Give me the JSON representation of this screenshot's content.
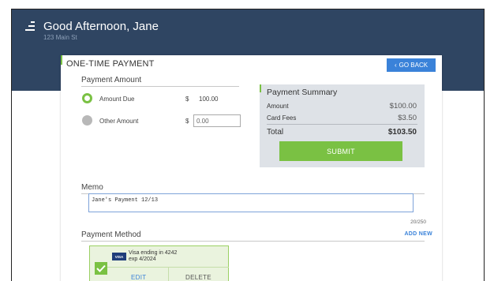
{
  "header": {
    "greeting": "Good Afternoon, Jane",
    "address": "123 Main St"
  },
  "card": {
    "title": "ONE-TIME PAYMENT",
    "go_back_label": "GO BACK",
    "go_back_icon": "chevron-left-icon"
  },
  "payment_amount": {
    "section_label": "Payment Amount",
    "options": [
      {
        "label": "Amount Due",
        "currency": "$",
        "value": "100.00",
        "selected": true
      },
      {
        "label": "Other Amount",
        "currency": "$",
        "placeholder": "0.00",
        "selected": false
      }
    ]
  },
  "summary": {
    "title": "Payment Summary",
    "rows": [
      {
        "label": "Amount",
        "value": "$100.00"
      },
      {
        "label": "Card Fees",
        "value": "$3.50"
      }
    ],
    "total_label": "Total",
    "total_value": "$103.50",
    "submit_label": "SUBMIT"
  },
  "memo": {
    "label": "Memo",
    "value": "Jane's Payment 12/13",
    "char_count": "20/250"
  },
  "payment_method": {
    "label": "Payment Method",
    "add_new_label": "ADD NEW",
    "cards": [
      {
        "brand": "VISA",
        "line1": "Visa ending in 4242",
        "line2": "exp 4/2024",
        "selected": true,
        "edit_label": "EDIT",
        "delete_label": "DELETE"
      }
    ]
  },
  "colors": {
    "header_bg": "#2f4562",
    "accent_green": "#7ac143",
    "link_blue": "#3a82d9",
    "summary_bg": "#dee2e7"
  }
}
